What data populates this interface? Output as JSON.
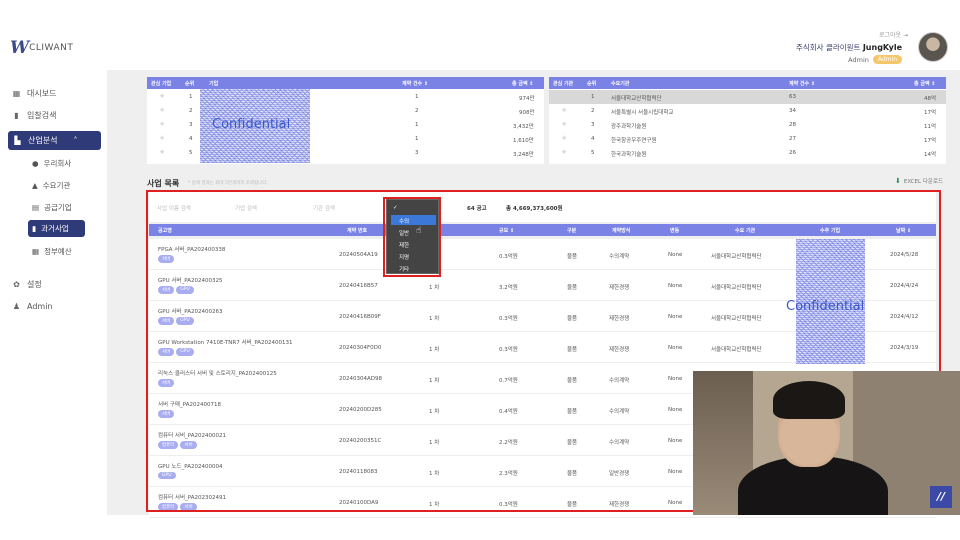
{
  "header": {
    "logo_text": "CLIWANT",
    "logout": "로그아웃",
    "company_prefix": "주식회사 클라이원트",
    "username": "JungKyle",
    "role_label": "Admin",
    "role_badge": "Admin"
  },
  "sidebar": {
    "items": [
      {
        "label": "대시보드",
        "icon": "grid-icon"
      },
      {
        "label": "입찰검색",
        "icon": "document-icon"
      },
      {
        "label": "산업분석",
        "icon": "bar-chart-icon"
      },
      {
        "label": "설정",
        "icon": "gear-icon"
      },
      {
        "label": "Admin",
        "icon": "user-icon"
      }
    ],
    "sub_items": [
      {
        "label": "우리회사",
        "icon": "person-icon"
      },
      {
        "label": "수요기관",
        "icon": "building-icon"
      },
      {
        "label": "공급기업",
        "icon": "list-icon"
      },
      {
        "label": "과거사업",
        "icon": "file-icon"
      },
      {
        "label": "정부예산",
        "icon": "table-icon"
      }
    ]
  },
  "left_table": {
    "headers": [
      "관심 기업",
      "순위",
      "기업",
      "계약 건수 ⇕",
      "총 금액 ⇕"
    ],
    "rows": [
      {
        "rank": "1",
        "count": "1",
        "amount": "974만"
      },
      {
        "rank": "2",
        "count": "2",
        "amount": "908만"
      },
      {
        "rank": "3",
        "count": "1",
        "amount": "3,432만"
      },
      {
        "rank": "4",
        "count": "1",
        "amount": "1,610만"
      },
      {
        "rank": "5",
        "count": "3",
        "amount": "3,248만"
      }
    ]
  },
  "right_table": {
    "headers": [
      "관심 기관",
      "순위",
      "수요기관",
      "계약 건수 ⇕",
      "총 금액 ⇕"
    ],
    "rows": [
      {
        "rank": "1",
        "name": "서울대학교산학협력단",
        "count": "63",
        "amount": "48억"
      },
      {
        "rank": "2",
        "name": "서울특별시 서울시립대학교",
        "count": "34",
        "amount": "17억"
      },
      {
        "rank": "3",
        "name": "광주과학기술원",
        "count": "28",
        "amount": "11억"
      },
      {
        "rank": "4",
        "name": "한국항공우주연구원",
        "count": "27",
        "amount": "17억"
      },
      {
        "rank": "5",
        "name": "한국과학기술원",
        "count": "26",
        "amount": "14억"
      }
    ]
  },
  "confidential_label": "Confidential",
  "projects": {
    "title": "사업 목록",
    "note": "* 검색 결과는 최대 5만개까지 조회됩니다.",
    "excel": "EXCEL 다운로드",
    "filters": {
      "name": "사업 이름 검색",
      "company": "기업 검색",
      "agency": "기관 검색"
    },
    "count_summary": "64 공고",
    "amount_summary": "총 4,669,373,600원",
    "dropdown": {
      "options": [
        "✓",
        "수의",
        "일반",
        "제한",
        "지명",
        "기타"
      ]
    },
    "headers": [
      "공고명",
      "계약 번호",
      "차수",
      "규모 ⇕",
      "구분",
      "계약방식",
      "변동",
      "수요 기관",
      "수주 기업",
      "날짜 ⇕"
    ],
    "rows": [
      {
        "name": "FPGA 서버_PA202400338",
        "tags": [
          "서버"
        ],
        "no": "20240504A19",
        "round": "1 차",
        "size": "0.3억원",
        "type": "물품",
        "method": "수의계약",
        "change": "None",
        "agency": "서울대학교산학협력단",
        "date": "2024/5/28"
      },
      {
        "name": "GPU 서버_PA202400325",
        "tags": [
          "서버",
          "GPU"
        ],
        "no": "20240416B57",
        "round": "1 차",
        "size": "3.2억원",
        "type": "물품",
        "method": "제한경쟁",
        "change": "None",
        "agency": "서울대학교산학협력단",
        "date": "2024/4/24"
      },
      {
        "name": "GPU 서버_PA202400263",
        "tags": [
          "서버",
          "GPU"
        ],
        "no": "20240416B09F",
        "round": "1 차",
        "size": "0.3억원",
        "type": "물품",
        "method": "제한경쟁",
        "change": "None",
        "agency": "서울대학교산학협력단",
        "date": "2024/4/12"
      },
      {
        "name": "GPU Workstation 7410E-TNR7 서버_PA202400131",
        "tags": [
          "서버",
          "GPU"
        ],
        "no": "20240304F0D0",
        "round": "1 차",
        "size": "0.3억원",
        "type": "물품",
        "method": "제한경쟁",
        "change": "None",
        "agency": "서울대학교산학협력단",
        "date": "2024/3/19"
      },
      {
        "name": "리눅스 클러스터 서버 및 스토리지_PA202400125",
        "tags": [
          "서버"
        ],
        "no": "20240304AD98",
        "round": "1 차",
        "size": "0.7억원",
        "type": "물품",
        "method": "수의계약",
        "change": "None",
        "agency": "",
        "date": ""
      },
      {
        "name": "서버 구매_PA202400718",
        "tags": [
          "서버"
        ],
        "no": "20240200D285",
        "round": "1 차",
        "size": "0.4억원",
        "type": "물품",
        "method": "수의계약",
        "change": "None",
        "agency": "",
        "date": ""
      },
      {
        "name": "컴퓨터 서버_PA202400021",
        "tags": [
          "컴퓨터",
          "서버"
        ],
        "no": "20240200351C",
        "round": "1 차",
        "size": "2.2억원",
        "type": "물품",
        "method": "수의계약",
        "change": "None",
        "agency": "",
        "date": ""
      },
      {
        "name": "GPU 노드_PA202400004",
        "tags": [
          "GPU"
        ],
        "no": "20240118083",
        "round": "1 차",
        "size": "2.3억원",
        "type": "물품",
        "method": "일반경쟁",
        "change": "None",
        "agency": "",
        "date": ""
      },
      {
        "name": "컴퓨터 서버_PA202302491",
        "tags": [
          "컴퓨터",
          "서버"
        ],
        "no": "20240100DA9",
        "round": "1 차",
        "size": "0.3억원",
        "type": "물품",
        "method": "제한경쟁",
        "change": "None",
        "agency": "",
        "date": ""
      }
    ]
  }
}
